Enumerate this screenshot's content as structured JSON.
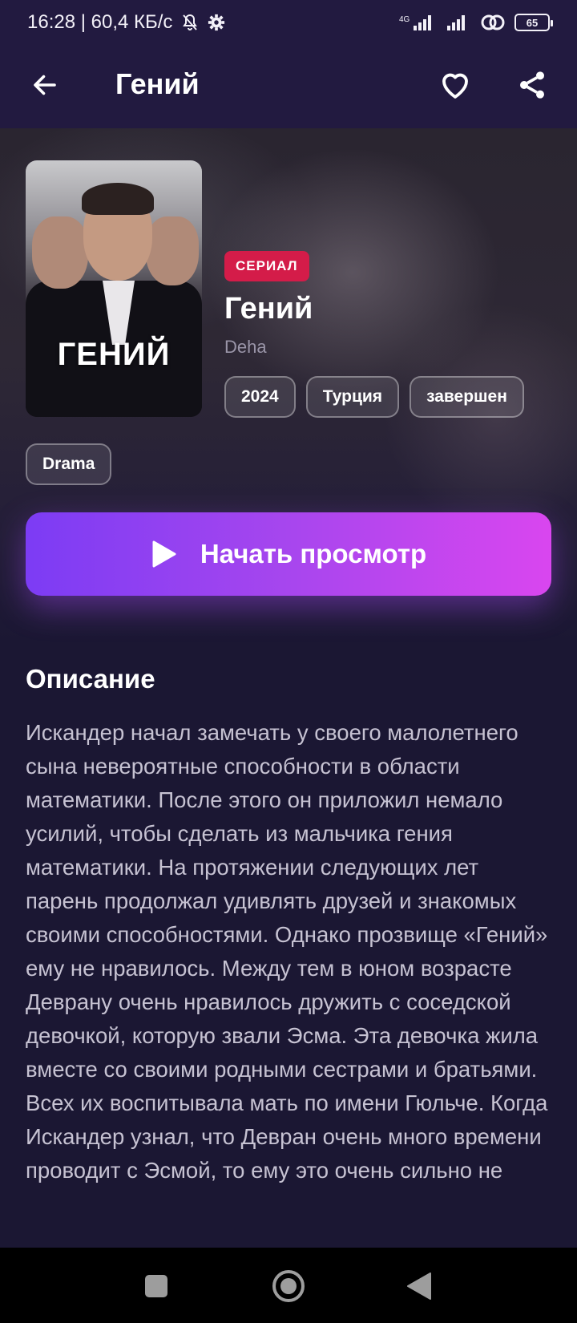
{
  "status_bar": {
    "time_speed": "16:28 | 60,4 КБ/с",
    "network_label": "4G",
    "battery": "65"
  },
  "app_bar": {
    "title": "Гений"
  },
  "show": {
    "poster_title": "ГЕНИЙ",
    "type_badge": "СЕРИАЛ",
    "title": "Гений",
    "original_title": "Deha",
    "chips": [
      "2024",
      "Турция",
      "завершен"
    ],
    "genres": [
      "Drama"
    ]
  },
  "watch_button": {
    "label": "Начать просмотр"
  },
  "description": {
    "heading": "Описание",
    "text": "Искандер начал замечать у своего малолетнего сына невероятные способности в области математики. После этого он приложил немало усилий, чтобы сделать из мальчика гения математики. На протяжении следующих лет парень продолжал удивлять друзей и знакомых своими способностями. Однако прозвище «Гений» ему не нравилось. Между тем в юном возрасте Деврану очень нравилось дружить с соседской девочкой, которую звали Эсма. Эта девочка жила вместе со своими родными сестрами и братьями. Всех их воспитывала мать по имени Гюльче. Когда Искандер узнал, что Девран очень много времени проводит с Эсмой, то ему это очень сильно не"
  },
  "colors": {
    "background": "#1b1733",
    "app_bar": "#221a40",
    "badge": "#d41c49",
    "button_start": "#7c3cf4",
    "button_end": "#d946ef"
  },
  "icons": {
    "back": "arrow-left-icon",
    "favorite": "heart-icon",
    "share": "share-icon",
    "play": "play-icon",
    "nav_recents": "square-icon",
    "nav_home": "circle-icon",
    "nav_back": "triangle-back-icon"
  }
}
